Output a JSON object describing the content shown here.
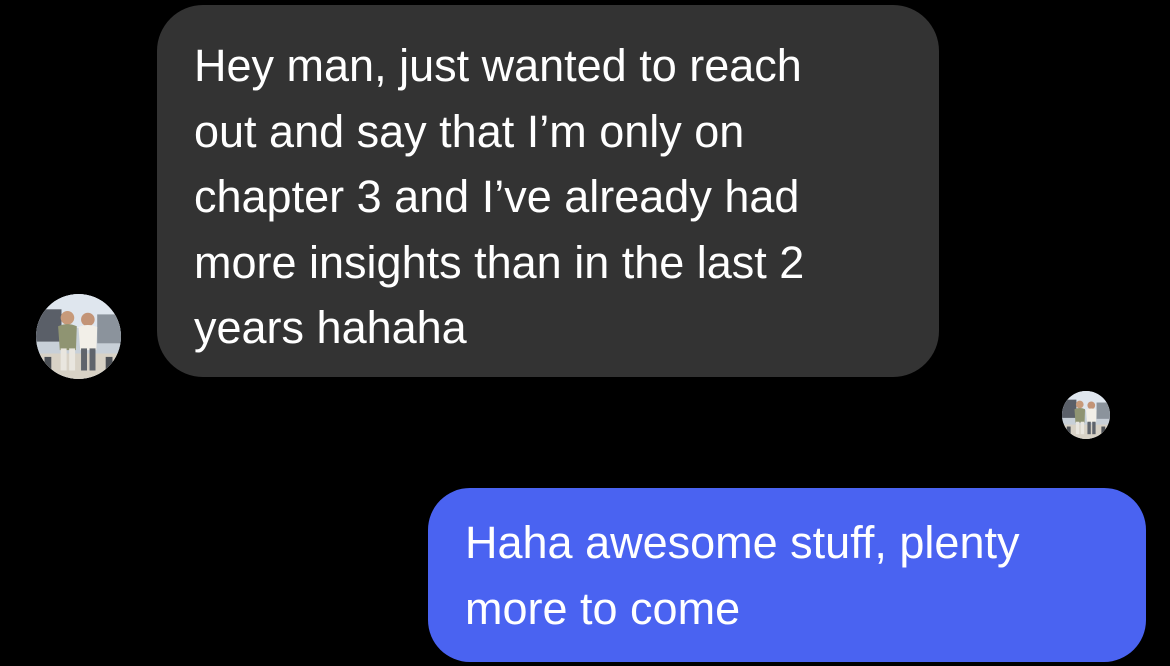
{
  "conversation": {
    "messages": [
      {
        "direction": "incoming",
        "lines": [
          "Hey man, just wanted to reach",
          "out and say that I’m only on",
          "chapter 3 and I’ve already had",
          "more insights than in the last 2",
          "years hahaha"
        ]
      },
      {
        "direction": "outgoing",
        "lines": [
          "Haha awesome stuff, plenty",
          "more to come"
        ]
      }
    ],
    "colors": {
      "background": "#000000",
      "incoming_bubble": "#333333",
      "outgoing_bubble": "#4a63f1",
      "text": "#ffffff"
    },
    "icons": {
      "sender_avatar": "sender-avatar-photo",
      "read_receipt": "read-receipt-avatar-photo"
    }
  }
}
